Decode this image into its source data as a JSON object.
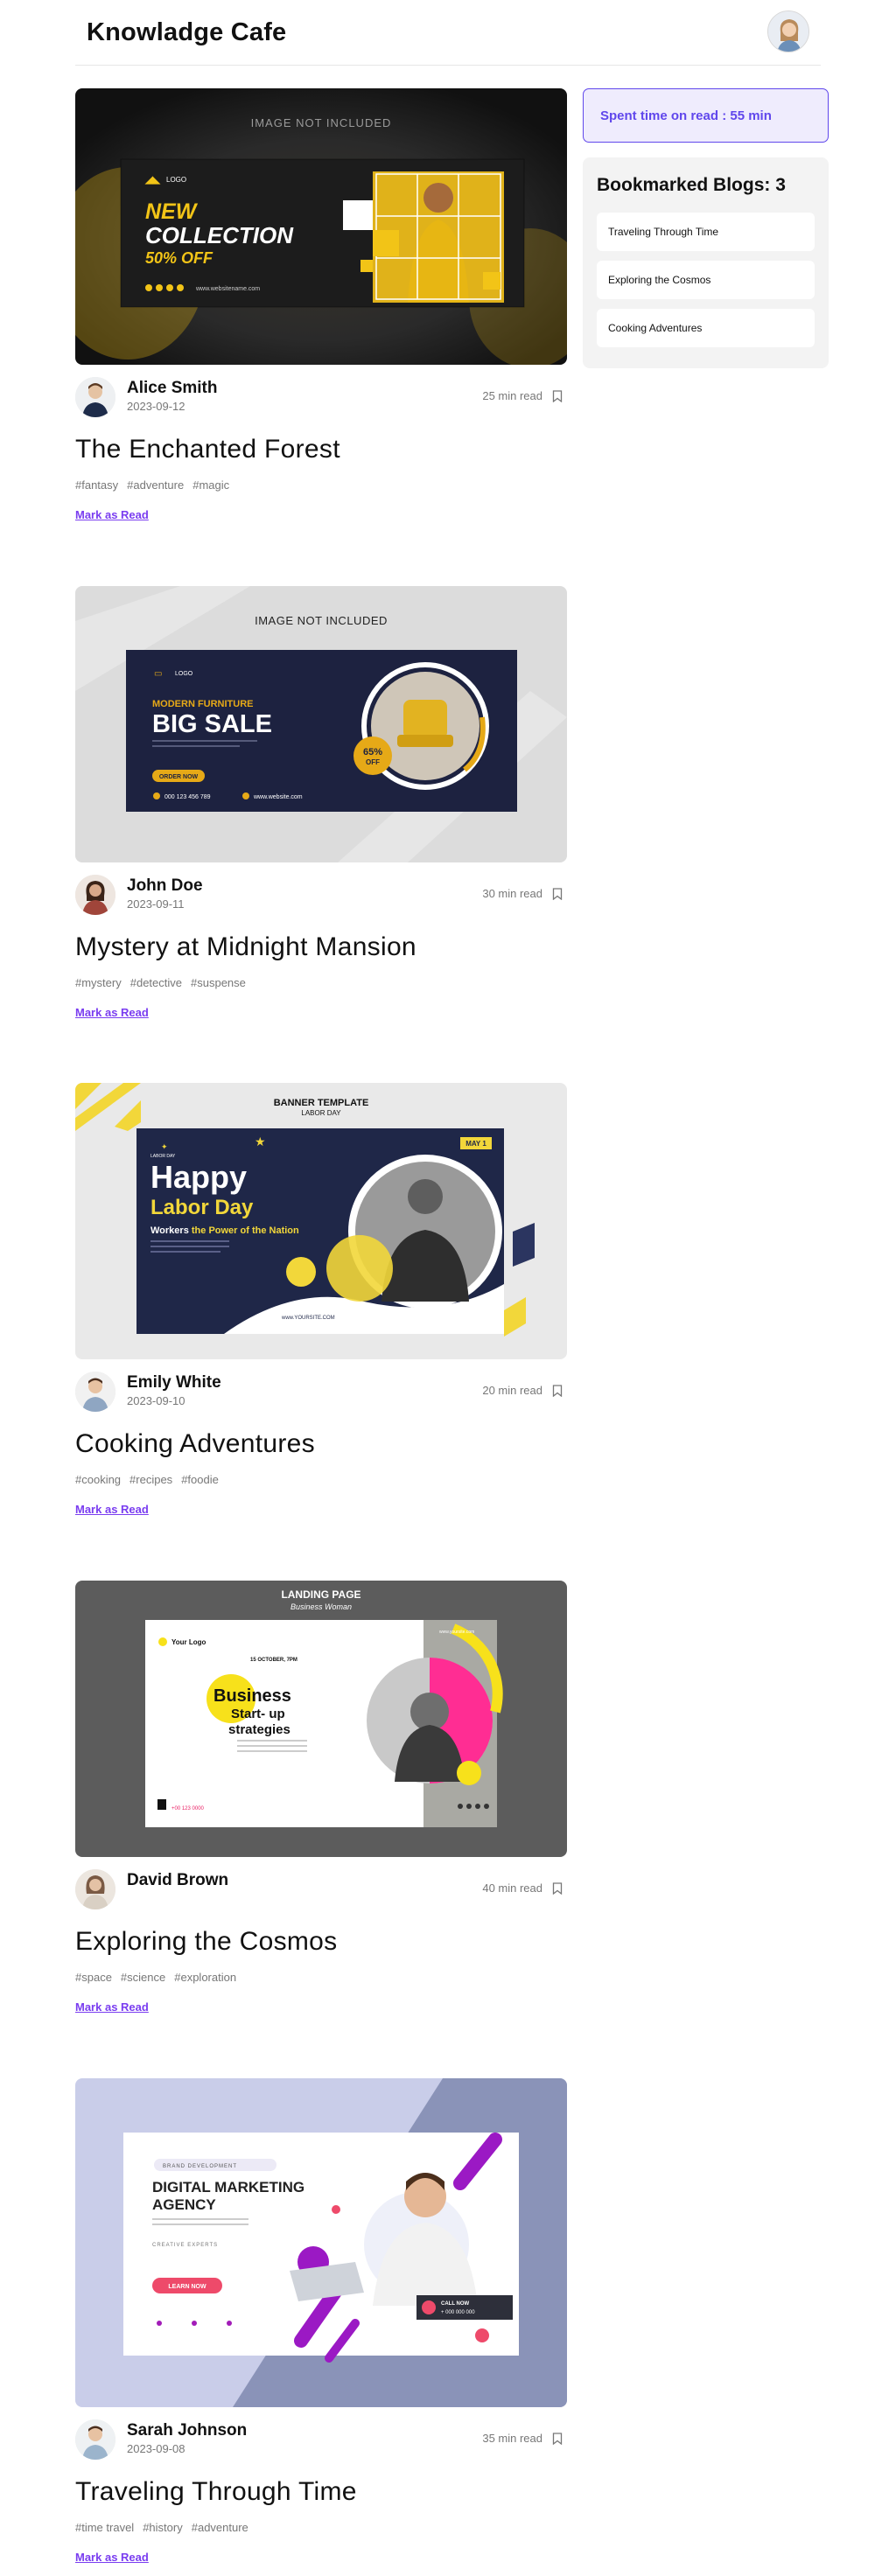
{
  "header": {
    "brand": "Knowladge Cafe"
  },
  "sidebar": {
    "spent_text": "Spent time on read : 55 min",
    "bookmarks_title": "Bookmarked Blogs: 3",
    "bookmarks": [
      "Traveling Through Time",
      "Exploring the Cosmos",
      "Cooking Adventures"
    ]
  },
  "blogs": [
    {
      "author": "Alice Smith",
      "date": "2023-09-12",
      "read_time": "25 min read",
      "title": "The Enchanted Forest",
      "tags": [
        "#fantasy",
        "#adventure",
        "#magic"
      ],
      "mark_label": "Mark as Read",
      "cover": {
        "watermark": "IMAGE NOT INCLUDED",
        "logo": "LOGO",
        "line1": "NEW",
        "line2": "COLLECTION",
        "line3": "50% OFF",
        "site": "www.websitename.com"
      }
    },
    {
      "author": "John Doe",
      "date": "2023-09-11",
      "read_time": "30 min read",
      "title": "Mystery at Midnight Mansion",
      "tags": [
        "#mystery",
        "#detective",
        "#suspense"
      ],
      "mark_label": "Mark as Read",
      "cover": {
        "watermark": "IMAGE NOT INCLUDED",
        "logo": "LOGO",
        "line1": "MODERN FURNITURE",
        "line2": "BIG SALE",
        "badge_top": "65%",
        "badge_bottom": "OFF",
        "cta": "ORDER NOW",
        "phone": "000 123 456 789",
        "site": "www.website.com"
      }
    },
    {
      "author": "Emily White",
      "date": "2023-09-10",
      "read_time": "20 min read",
      "title": "Cooking Adventures",
      "tags": [
        "#cooking",
        "#recipes",
        "#foodie"
      ],
      "mark_label": "Mark as Read",
      "cover": {
        "header1": "BANNER TEMPLATE",
        "header2": "LABOR DAY",
        "line1": "Happy",
        "line2": "Labor Day",
        "line3a": "Workers",
        "line3b": "the Power of the Nation",
        "date_badge": "MAY 1",
        "site": "www.YOURSITE.COM",
        "small_logo": "LABOR DAY"
      }
    },
    {
      "author": "David Brown",
      "date": "",
      "read_time": "40 min read",
      "title": "Exploring the Cosmos",
      "tags": [
        "#space",
        "#science",
        "#exploration"
      ],
      "mark_label": "Mark as Read",
      "cover": {
        "header1": "LANDING PAGE",
        "header2": "Business Woman",
        "logo": "Your Logo",
        "date": "15 OCTOBER, 7PM",
        "line1": "Business",
        "line2": "Start- up",
        "line3": "strategies",
        "site": "www.yoursite.com",
        "phone": "+00 123 0000"
      }
    },
    {
      "author": "Sarah Johnson",
      "date": "2023-09-08",
      "read_time": "35 min read",
      "title": "Traveling Through Time",
      "tags": [
        "#time travel",
        "#history",
        "#adventure"
      ],
      "mark_label": "Mark as Read",
      "cover": {
        "tag": "BRAND DEVELOPMENT",
        "line1": "DIGITAL MARKETING",
        "line2": "AGENCY",
        "sub": "CREATIVE EXPERTS",
        "cta": "LEARN NOW",
        "call": "CALL NOW",
        "phone": "+ 000 000 000"
      }
    }
  ]
}
